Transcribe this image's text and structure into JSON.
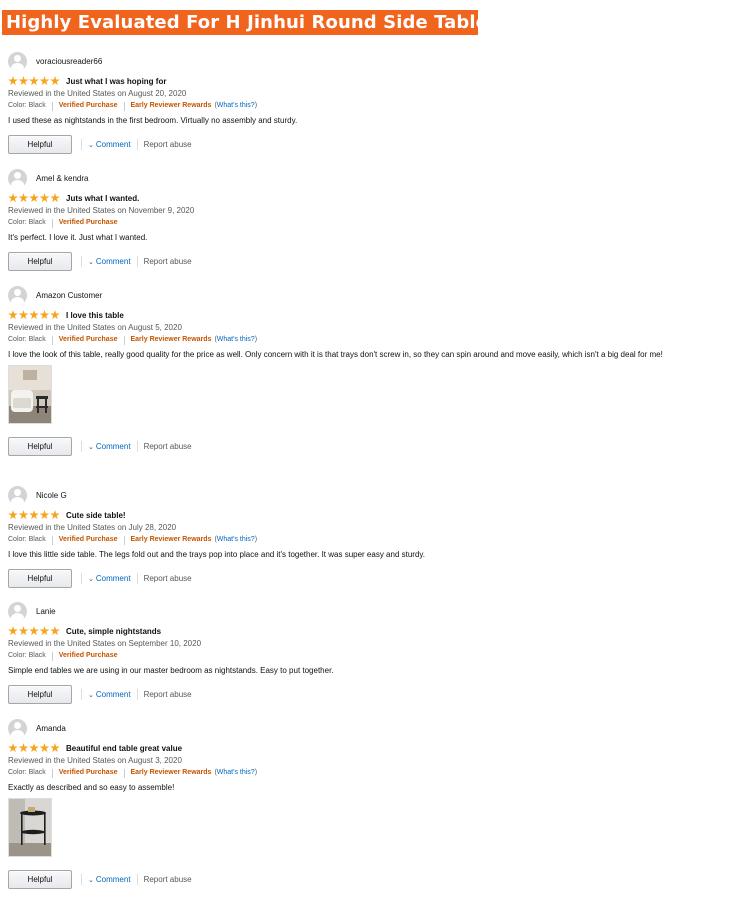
{
  "banner": {
    "title": "Highly Evaluated For H Jinhui  Round Side Table"
  },
  "labels": {
    "helpful": "Helpful",
    "comment": "Comment",
    "report": "Report abuse",
    "verified": "Verified Purchase",
    "rewards": "Early Reviewer Rewards",
    "whats_this": "What's this?"
  },
  "reviews": [
    {
      "user": "voraciousreader66",
      "rating": 5,
      "title": "Just what I was hoping for",
      "date": "Reviewed in the United States on August 20, 2020",
      "color": "Color: Black",
      "early_reviewer": true,
      "text": "I used these as nightstands in the first bedroom. Virtually no assembly and sturdy.",
      "photo": false
    },
    {
      "user": "Amel & kendra",
      "rating": 5,
      "title": "Juts what I wanted.",
      "date": "Reviewed in the United States on November 9, 2020",
      "color": "Color: Black",
      "early_reviewer": false,
      "text": "It's perfect. I love it. Just what I wanted.",
      "photo": false
    },
    {
      "user": "Amazon Customer",
      "rating": 5,
      "title": "I love this table",
      "date": "Reviewed in the United States on August 5, 2020",
      "color": "Color: Black",
      "early_reviewer": true,
      "text": "I love the look of this table, really good quality for the price as well. Only concern with it is that trays don't screw in, so they can spin around and move easily, which isn't a big deal for me!",
      "photo": true
    },
    {
      "user": "Nicole G",
      "rating": 5,
      "title": "Cute side table!",
      "date": "Reviewed in the United States on July 28, 2020",
      "color": "Color: Black",
      "early_reviewer": true,
      "text": "I love this little side table. The legs fold out and the trays pop into place and it's together. It was super easy and sturdy.",
      "photo": false
    },
    {
      "user": "Lanie",
      "rating": 5,
      "title": "Cute, simple nightstands",
      "date": "Reviewed in the United States on September 10, 2020",
      "color": "Color: Black",
      "early_reviewer": false,
      "text": "Simple end tables we are using in our master bedroom as nightstands. Easy to put together.",
      "photo": false
    },
    {
      "user": "Amanda",
      "rating": 5,
      "title": "Beautiful end table great value",
      "date": "Reviewed in the United States on August 3, 2020",
      "color": "Color: Black",
      "early_reviewer": true,
      "text": "Exactly as described and so easy to assemble!",
      "photo": true
    }
  ]
}
